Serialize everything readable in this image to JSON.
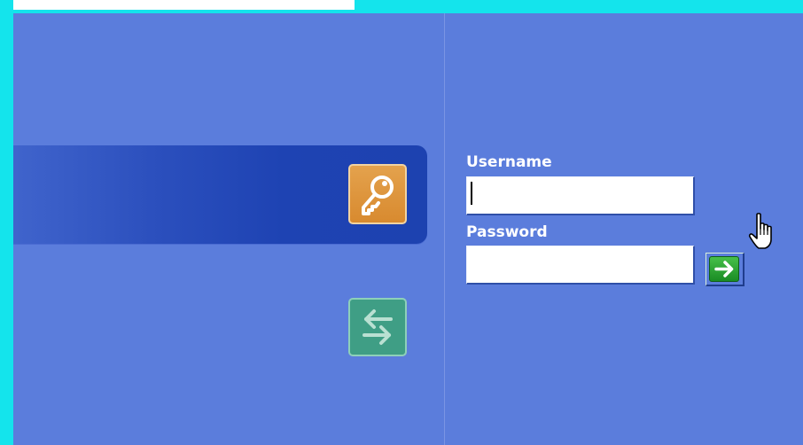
{
  "login": {
    "username_label": "Username",
    "username_value": "",
    "password_label": "Password",
    "password_value": ""
  },
  "icons": {
    "key": "key-icon",
    "switch": "switch-arrows-icon",
    "go": "arrow-right-icon",
    "cursor": "hand-pointer-cursor-icon"
  },
  "colors": {
    "panel_background": "#5b7ddc",
    "banner": "#1e43b3",
    "frame": "#14e4ec",
    "key_button": "#d88a2f",
    "switch_button": "#3f9e85",
    "go_button": "#2ea838"
  }
}
